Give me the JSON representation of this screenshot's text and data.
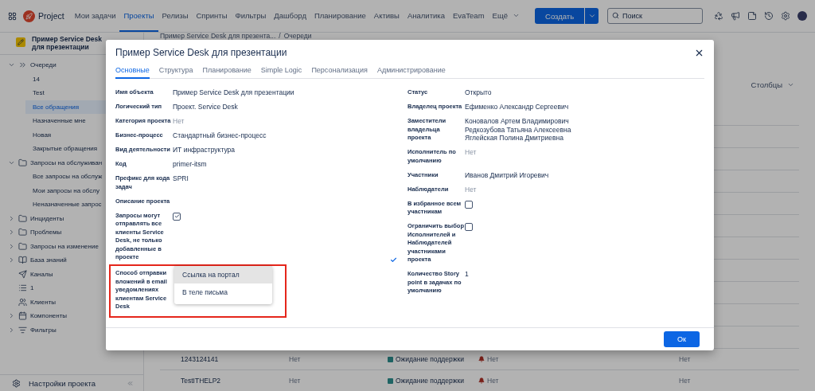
{
  "topbar": {
    "app_name": "Project",
    "items": [
      {
        "label": "Мои задачи",
        "selected": false
      },
      {
        "label": "Проекты",
        "selected": true
      },
      {
        "label": "Релизы",
        "selected": false
      },
      {
        "label": "Спринты",
        "selected": false
      },
      {
        "label": "Фильтры",
        "selected": false
      },
      {
        "label": "Дашборд",
        "selected": false
      },
      {
        "label": "Планирование",
        "selected": false
      },
      {
        "label": "Активы",
        "selected": false
      },
      {
        "label": "Аналитика",
        "selected": false
      },
      {
        "label": "EvaTeam",
        "selected": false
      }
    ],
    "more": "Ещё",
    "create": "Создать",
    "search": {
      "placeholder": "Поиск"
    }
  },
  "sidebar": {
    "project": "Пример Service Desk для презентации",
    "items": [
      {
        "label": "Очереди",
        "kind": "queue",
        "expanded": true,
        "children": [
          {
            "label": "14",
            "selected": false
          },
          {
            "label": "Test",
            "selected": false
          },
          {
            "label": "Все обращения",
            "selected": true
          },
          {
            "label": "Назначенные мне",
            "selected": false
          },
          {
            "label": "Новая",
            "selected": false
          },
          {
            "label": "Закрытые обращения",
            "selected": false
          }
        ]
      },
      {
        "label": "Запросы на обслуживан",
        "kind": "folder",
        "expanded": true,
        "children": [
          {
            "label": "Все запросы на обслуж",
            "selected": false
          },
          {
            "label": "Мои запросы на обслу",
            "selected": false
          },
          {
            "label": "Неназначенные запрос",
            "selected": false
          }
        ]
      },
      {
        "label": "Инциденты",
        "kind": "folder",
        "expanded": false
      },
      {
        "label": "Проблемы",
        "kind": "folder",
        "expanded": false
      },
      {
        "label": "Запросы на изменение",
        "kind": "folder",
        "expanded": false
      },
      {
        "label": "База знаний",
        "kind": "book",
        "expanded": false
      },
      {
        "label": "Каналы",
        "kind": "channel"
      },
      {
        "label": "1",
        "kind": "list"
      },
      {
        "label": "Клиенты",
        "kind": "people"
      },
      {
        "label": "Компоненты",
        "kind": "components",
        "expanded": false
      },
      {
        "label": "Фильтры",
        "kind": "filter",
        "expanded": false
      }
    ],
    "settings": "Настройки проекта"
  },
  "main": {
    "breadcrumb": [
      "Пример Service Desk для презента...",
      "Очереди"
    ],
    "breadcrumb_separator": "/",
    "columns_button": "Столбцы",
    "rows": [
      {
        "column_1": "1243124141",
        "column_2": "Нет",
        "status": "Ожидание поддержки",
        "color": "#1f6464",
        "priority": "Нет",
        "column_5": "Нет"
      },
      {
        "column_1": "TestITHELP2",
        "column_2": "Нет",
        "status": "Ожидание поддержки",
        "color": "#1f6464",
        "priority": "Нет",
        "column_5": "Нет"
      }
    ]
  },
  "dialog": {
    "title": "Пример Service Desk для презентации",
    "tabs": [
      {
        "label": "Основные",
        "selected": true
      },
      {
        "label": "Структура",
        "selected": false
      },
      {
        "label": "Планирование",
        "selected": false
      },
      {
        "label": "Simple Logic",
        "selected": false
      },
      {
        "label": "Персонализация",
        "selected": false
      },
      {
        "label": "Администрирование",
        "selected": false
      }
    ],
    "left_fields": [
      {
        "label": "Имя объекта",
        "kind": "text",
        "values": [
          "Пример Service Desk для презентации"
        ]
      },
      {
        "label": "Логический тип",
        "kind": "text",
        "values": [
          "Проект. Service Desk"
        ]
      },
      {
        "label": "Категория проекта",
        "kind": "empty",
        "values": [
          "Нет"
        ]
      },
      {
        "label": "Бизнес-процесс",
        "kind": "text",
        "values": [
          "Стандартный бизнес-процесс"
        ]
      },
      {
        "label": "Вид деятельности",
        "kind": "text",
        "values": [
          "ИТ инфраструктура"
        ]
      },
      {
        "label": "Код",
        "kind": "text",
        "values": [
          "primer-itsm"
        ]
      },
      {
        "label": "Префикс для кода задач",
        "kind": "text",
        "values": [
          "SPRI"
        ]
      },
      {
        "label": "Описание проекта",
        "kind": "text"
      },
      {
        "label": "Запросы могут отправлять все клиенты Service Desk, не только добавленные в проекте",
        "kind": "checkbox",
        "checked": true
      },
      {
        "label": "Способ отправки вложений в email уведомлениях клиентам Service Desk",
        "kind": "select",
        "highlighted": true,
        "options": [
          {
            "label": "Ссылка на портал",
            "selected": true
          },
          {
            "label": "В теле письма",
            "selected": false
          }
        ]
      }
    ],
    "right_fields": [
      {
        "label": "Статус",
        "kind": "text",
        "values": [
          "Открыто"
        ]
      },
      {
        "label": "Владелец проекта",
        "kind": "text",
        "values": [
          "Ефименко Александр Сергеевич"
        ]
      },
      {
        "label": "Заместители владельца проекта",
        "kind": "text",
        "values": [
          "Коновалов Артем Владимирович",
          "Редкозубова Татьяна Алексеевна",
          "Яглейская Полина Дмитриевна"
        ]
      },
      {
        "label": "Исполнитель по умолчанию",
        "kind": "empty",
        "values": [
          "Нет"
        ]
      },
      {
        "label": "Участники",
        "kind": "text",
        "values": [
          "Иванов Дмитрий Игоревич"
        ]
      },
      {
        "label": "Наблюдатели",
        "kind": "empty",
        "values": [
          "Нет"
        ]
      },
      {
        "label": "В избранное всем участникам",
        "kind": "checkbox",
        "checked": false
      },
      {
        "label": "Ограничить выбор Исполнителей и Наблюдателей участниками проекта",
        "kind": "checkbox",
        "checked": false
      },
      {
        "label": "Количество Story point в задачах по умолчанию",
        "kind": "text",
        "values": [
          "1"
        ]
      }
    ],
    "ok": "Ок"
  }
}
